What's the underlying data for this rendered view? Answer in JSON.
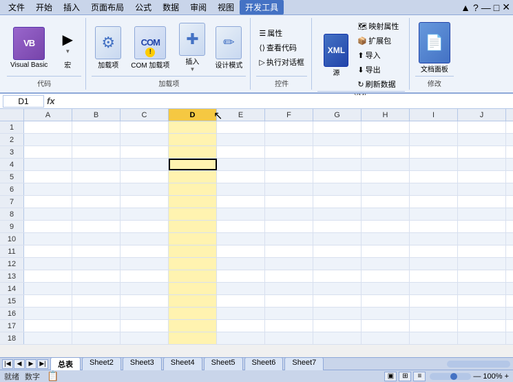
{
  "menubar": {
    "items": [
      "文件",
      "开始",
      "插入",
      "页面布局",
      "公式",
      "数据",
      "审阅",
      "视图",
      "开发工具"
    ]
  },
  "ribbon": {
    "active_tab": "开发工具",
    "groups": [
      {
        "label": "代码",
        "items": [
          {
            "id": "vb",
            "label": "Visual Basic",
            "icon": "VB"
          },
          {
            "id": "macro",
            "label": "宏",
            "icon": "▶"
          }
        ]
      },
      {
        "label": "加载项",
        "items": [
          {
            "id": "addins",
            "label": "加载项",
            "icon": "🔧"
          },
          {
            "id": "com",
            "label": "COM 加载项",
            "icon": "COM"
          },
          {
            "id": "insert",
            "label": "插入",
            "icon": "✚"
          },
          {
            "id": "design",
            "label": "设计模式",
            "icon": "✏"
          }
        ]
      },
      {
        "label": "控件",
        "items": [
          {
            "id": "prop",
            "label": "属性",
            "icon": "☰"
          },
          {
            "id": "viewcode",
            "label": "查看代码",
            "icon": "⟨⟩"
          },
          {
            "id": "dialog",
            "label": "执行对话框",
            "icon": "▷"
          }
        ]
      },
      {
        "label": "XML",
        "items": [
          {
            "id": "source",
            "label": "源",
            "icon": "XML"
          },
          {
            "id": "mapprop",
            "label": "映射属性",
            "icon": "🗺"
          },
          {
            "id": "expand",
            "label": "扩展包",
            "icon": "📦"
          },
          {
            "id": "export",
            "label": "导入",
            "icon": "⬆"
          },
          {
            "id": "export2",
            "label": "导出",
            "icon": "⬇"
          },
          {
            "id": "refresh",
            "label": "刷新数据",
            "icon": "↻"
          }
        ]
      },
      {
        "label": "修改",
        "items": [
          {
            "id": "docpanel",
            "label": "文档面板",
            "icon": "📄"
          }
        ]
      }
    ]
  },
  "formulabar": {
    "cell_ref": "D1",
    "content": ""
  },
  "columns": [
    "A",
    "B",
    "C",
    "D",
    "E",
    "F",
    "G",
    "H",
    "I",
    "J"
  ],
  "rows": [
    1,
    2,
    3,
    4,
    5,
    6,
    7,
    8,
    9,
    10,
    11,
    12,
    13,
    14,
    15,
    16,
    17,
    18
  ],
  "active_cell": {
    "row": 4,
    "col": 3
  },
  "selected_col": 3,
  "sheet_tabs": [
    "总表",
    "Sheet2",
    "Sheet3",
    "Sheet4",
    "Sheet5",
    "Sheet6",
    "Sheet7"
  ],
  "active_tab_index": 0,
  "status": {
    "left": [
      "就绪",
      "数字"
    ],
    "zoom": "100%"
  }
}
